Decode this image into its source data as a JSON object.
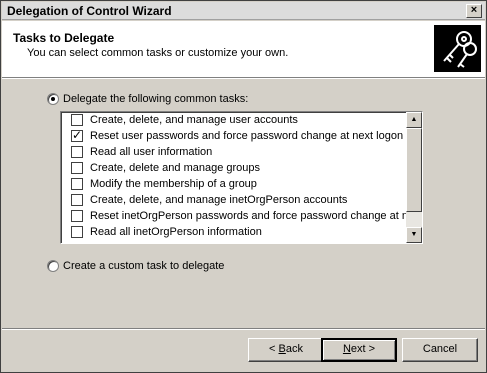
{
  "window": {
    "title": "Delegation of Control Wizard",
    "close_glyph": "×"
  },
  "header": {
    "title": "Tasks to Delegate",
    "subtitle": "You can select common tasks or customize your own.",
    "icon": "keys-icon"
  },
  "options": {
    "common_label": "Delegate the following common tasks:",
    "common_selected": true,
    "custom_label": "Create a custom task to delegate",
    "custom_selected": false
  },
  "tasks": [
    {
      "label": "Create, delete, and manage user accounts",
      "checked": false
    },
    {
      "label": "Reset user passwords and force password change at next logon",
      "checked": true
    },
    {
      "label": "Read all user information",
      "checked": false
    },
    {
      "label": "Create, delete and manage groups",
      "checked": false
    },
    {
      "label": "Modify the membership of a group",
      "checked": false
    },
    {
      "label": "Create, delete, and manage inetOrgPerson accounts",
      "checked": false
    },
    {
      "label": "Reset inetOrgPerson passwords and force password change at ne...",
      "checked": false
    },
    {
      "label": "Read all inetOrgPerson information",
      "checked": false
    }
  ],
  "scrollbar": {
    "up_glyph": "▲",
    "down_glyph": "▼"
  },
  "buttons": {
    "back_underline": "B",
    "back_rest": "ack",
    "back_prefix": "< ",
    "next_underline": "N",
    "next_rest": "ext >",
    "cancel": "Cancel"
  }
}
